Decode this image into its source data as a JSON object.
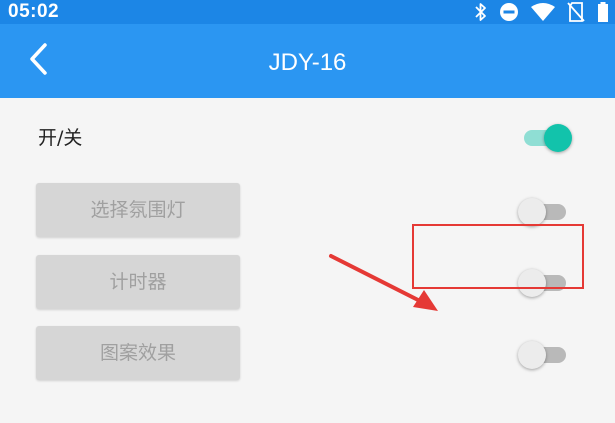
{
  "status_bar": {
    "time": "05:02",
    "icons": [
      "bluetooth-icon",
      "do-not-disturb-icon",
      "wifi-icon",
      "no-sim-icon",
      "battery-icon"
    ]
  },
  "app_bar": {
    "title": "JDY-16",
    "back_icon": "chevron-left-icon"
  },
  "settings": {
    "power": {
      "label": "开/关",
      "on": true
    },
    "rows": [
      {
        "label": "选择氛围灯",
        "switch_on": false
      },
      {
        "label": "计时器",
        "switch_on": false
      },
      {
        "label": "图案效果",
        "switch_on": false
      }
    ]
  },
  "annotation": {
    "highlight_color": "#e53935",
    "arrow_color": "#e53935"
  },
  "colors": {
    "status_bar": "#1c86e6",
    "app_bar": "#2b96f2",
    "switch_on_thumb": "#12c3ab",
    "switch_on_track": "#8fded4",
    "switch_off_thumb": "#ececec",
    "switch_off_track": "#b9b9b9",
    "button_bg": "#d6d6d6",
    "button_text": "#a0a0a0"
  }
}
